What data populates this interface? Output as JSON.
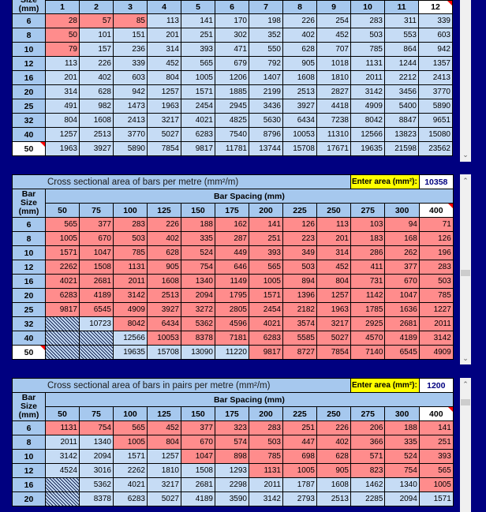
{
  "colors": {
    "background": "#000080",
    "header_fill": "#a6c8ee",
    "cell_fill": "#c6dcf5",
    "highlight_fill": "#ff8c8c",
    "enter_area_fill": "#ffff00"
  },
  "table1": {
    "row_header_label_partial": "Size",
    "row_header_unit": "(mm)",
    "columns": [
      "1",
      "2",
      "3",
      "4",
      "5",
      "6",
      "7",
      "8",
      "9",
      "10",
      "11",
      "12"
    ],
    "selected_column": "12",
    "rows": [
      {
        "size": "6",
        "values": [
          "28",
          "57",
          "85",
          "113",
          "141",
          "170",
          "198",
          "226",
          "254",
          "283",
          "311",
          "339"
        ],
        "flags": [
          "r",
          "r",
          "r",
          "l",
          "l",
          "l",
          "l",
          "l",
          "l",
          "l",
          "l",
          "l"
        ]
      },
      {
        "size": "8",
        "values": [
          "50",
          "101",
          "151",
          "201",
          "251",
          "302",
          "352",
          "402",
          "452",
          "503",
          "553",
          "603"
        ],
        "flags": [
          "r",
          "l",
          "l",
          "l",
          "l",
          "l",
          "l",
          "l",
          "l",
          "l",
          "l",
          "l"
        ]
      },
      {
        "size": "10",
        "values": [
          "79",
          "157",
          "236",
          "314",
          "393",
          "471",
          "550",
          "628",
          "707",
          "785",
          "864",
          "942"
        ],
        "flags": [
          "r",
          "l",
          "l",
          "l",
          "l",
          "l",
          "l",
          "l",
          "l",
          "l",
          "l",
          "l"
        ]
      },
      {
        "size": "12",
        "values": [
          "113",
          "226",
          "339",
          "452",
          "565",
          "679",
          "792",
          "905",
          "1018",
          "1131",
          "1244",
          "1357"
        ],
        "flags": [
          "l",
          "l",
          "l",
          "l",
          "l",
          "l",
          "l",
          "l",
          "l",
          "l",
          "l",
          "l"
        ]
      },
      {
        "size": "16",
        "values": [
          "201",
          "402",
          "603",
          "804",
          "1005",
          "1206",
          "1407",
          "1608",
          "1810",
          "2011",
          "2212",
          "2413"
        ],
        "flags": [
          "l",
          "l",
          "l",
          "l",
          "l",
          "l",
          "l",
          "l",
          "l",
          "l",
          "l",
          "l"
        ]
      },
      {
        "size": "20",
        "values": [
          "314",
          "628",
          "942",
          "1257",
          "1571",
          "1885",
          "2199",
          "2513",
          "2827",
          "3142",
          "3456",
          "3770"
        ],
        "flags": [
          "l",
          "l",
          "l",
          "l",
          "l",
          "l",
          "l",
          "l",
          "l",
          "l",
          "l",
          "l"
        ]
      },
      {
        "size": "25",
        "values": [
          "491",
          "982",
          "1473",
          "1963",
          "2454",
          "2945",
          "3436",
          "3927",
          "4418",
          "4909",
          "5400",
          "5890"
        ],
        "flags": [
          "l",
          "l",
          "l",
          "l",
          "l",
          "l",
          "l",
          "l",
          "l",
          "l",
          "l",
          "l"
        ]
      },
      {
        "size": "32",
        "values": [
          "804",
          "1608",
          "2413",
          "3217",
          "4021",
          "4825",
          "5630",
          "6434",
          "7238",
          "8042",
          "8847",
          "9651"
        ],
        "flags": [
          "l",
          "l",
          "l",
          "l",
          "l",
          "l",
          "l",
          "l",
          "l",
          "l",
          "l",
          "l"
        ]
      },
      {
        "size": "40",
        "values": [
          "1257",
          "2513",
          "3770",
          "5027",
          "6283",
          "7540",
          "8796",
          "10053",
          "11310",
          "12566",
          "13823",
          "15080"
        ],
        "flags": [
          "l",
          "l",
          "l",
          "l",
          "l",
          "l",
          "l",
          "l",
          "l",
          "l",
          "l",
          "l"
        ]
      },
      {
        "size": "50",
        "values": [
          "1963",
          "3927",
          "5890",
          "7854",
          "9817",
          "11781",
          "13744",
          "15708",
          "17671",
          "19635",
          "21598",
          "23562"
        ],
        "flags": [
          "l",
          "l",
          "l",
          "l",
          "l",
          "l",
          "l",
          "l",
          "l",
          "l",
          "l",
          "l"
        ],
        "selected": true
      }
    ]
  },
  "table2": {
    "title": "Cross sectional area of bars per metre (mm²/m)",
    "enter_label": "Enter area (mm²):",
    "enter_value": "10358",
    "bar_size_label": "Bar Size (mm)",
    "spacing_label": "Bar Spacing (mm)",
    "columns": [
      "50",
      "75",
      "100",
      "125",
      "150",
      "175",
      "200",
      "225",
      "250",
      "275",
      "300",
      "400"
    ],
    "selected_column": "400",
    "rows": [
      {
        "size": "6",
        "values": [
          "565",
          "377",
          "283",
          "226",
          "188",
          "162",
          "141",
          "126",
          "113",
          "103",
          "94",
          "71"
        ],
        "flags": [
          "r",
          "r",
          "r",
          "r",
          "r",
          "r",
          "r",
          "r",
          "r",
          "r",
          "r",
          "r"
        ]
      },
      {
        "size": "8",
        "values": [
          "1005",
          "670",
          "503",
          "402",
          "335",
          "287",
          "251",
          "223",
          "201",
          "183",
          "168",
          "126"
        ],
        "flags": [
          "r",
          "r",
          "r",
          "r",
          "r",
          "r",
          "r",
          "r",
          "r",
          "r",
          "r",
          "r"
        ]
      },
      {
        "size": "10",
        "values": [
          "1571",
          "1047",
          "785",
          "628",
          "524",
          "449",
          "393",
          "349",
          "314",
          "286",
          "262",
          "196"
        ],
        "flags": [
          "r",
          "r",
          "r",
          "r",
          "r",
          "r",
          "r",
          "r",
          "r",
          "r",
          "r",
          "r"
        ]
      },
      {
        "size": "12",
        "values": [
          "2262",
          "1508",
          "1131",
          "905",
          "754",
          "646",
          "565",
          "503",
          "452",
          "411",
          "377",
          "283"
        ],
        "flags": [
          "r",
          "r",
          "r",
          "r",
          "r",
          "r",
          "r",
          "r",
          "r",
          "r",
          "r",
          "r"
        ]
      },
      {
        "size": "16",
        "values": [
          "4021",
          "2681",
          "2011",
          "1608",
          "1340",
          "1149",
          "1005",
          "894",
          "804",
          "731",
          "670",
          "503"
        ],
        "flags": [
          "r",
          "r",
          "r",
          "r",
          "r",
          "r",
          "r",
          "r",
          "r",
          "r",
          "r",
          "r"
        ]
      },
      {
        "size": "20",
        "values": [
          "6283",
          "4189",
          "3142",
          "2513",
          "2094",
          "1795",
          "1571",
          "1396",
          "1257",
          "1142",
          "1047",
          "785"
        ],
        "flags": [
          "r",
          "r",
          "r",
          "r",
          "r",
          "r",
          "r",
          "r",
          "r",
          "r",
          "r",
          "r"
        ]
      },
      {
        "size": "25",
        "values": [
          "9817",
          "6545",
          "4909",
          "3927",
          "3272",
          "2805",
          "2454",
          "2182",
          "1963",
          "1785",
          "1636",
          "1227"
        ],
        "flags": [
          "r",
          "r",
          "r",
          "r",
          "r",
          "r",
          "r",
          "r",
          "r",
          "r",
          "r",
          "r"
        ]
      },
      {
        "size": "32",
        "values": [
          "",
          "10723",
          "8042",
          "6434",
          "5362",
          "4596",
          "4021",
          "3574",
          "3217",
          "2925",
          "2681",
          "2011"
        ],
        "flags": [
          "h",
          "l",
          "r",
          "r",
          "r",
          "r",
          "r",
          "r",
          "r",
          "r",
          "r",
          "r"
        ]
      },
      {
        "size": "40",
        "values": [
          "",
          "",
          "12566",
          "10053",
          "8378",
          "7181",
          "6283",
          "5585",
          "5027",
          "4570",
          "4189",
          "3142"
        ],
        "flags": [
          "h",
          "h",
          "l",
          "r",
          "r",
          "r",
          "r",
          "r",
          "r",
          "r",
          "r",
          "r"
        ]
      },
      {
        "size": "50",
        "values": [
          "",
          "",
          "19635",
          "15708",
          "13090",
          "11220",
          "9817",
          "8727",
          "7854",
          "7140",
          "6545",
          "4909"
        ],
        "flags": [
          "h",
          "h",
          "l",
          "l",
          "l",
          "l",
          "r",
          "r",
          "r",
          "r",
          "r",
          "r"
        ],
        "selected": true
      }
    ]
  },
  "table3": {
    "title": "Cross sectional area of bars in pairs per metre (mm²/m)",
    "enter_label": "Enter area (mm²):",
    "enter_value": "1200",
    "bar_size_label": "Bar Size (mm)",
    "spacing_label": "Bar Spacing (mm)",
    "columns": [
      "50",
      "75",
      "100",
      "125",
      "150",
      "175",
      "200",
      "225",
      "250",
      "275",
      "300",
      "400"
    ],
    "selected_column": "400",
    "rows": [
      {
        "size": "6",
        "values": [
          "1131",
          "754",
          "565",
          "452",
          "377",
          "323",
          "283",
          "251",
          "226",
          "206",
          "188",
          "141"
        ],
        "flags": [
          "r",
          "r",
          "r",
          "r",
          "r",
          "r",
          "r",
          "r",
          "r",
          "r",
          "r",
          "r"
        ]
      },
      {
        "size": "8",
        "values": [
          "2011",
          "1340",
          "1005",
          "804",
          "670",
          "574",
          "503",
          "447",
          "402",
          "366",
          "335",
          "251"
        ],
        "flags": [
          "l",
          "l",
          "r",
          "r",
          "r",
          "r",
          "r",
          "r",
          "r",
          "r",
          "r",
          "r"
        ]
      },
      {
        "size": "10",
        "values": [
          "3142",
          "2094",
          "1571",
          "1257",
          "1047",
          "898",
          "785",
          "698",
          "628",
          "571",
          "524",
          "393"
        ],
        "flags": [
          "l",
          "l",
          "l",
          "l",
          "r",
          "r",
          "r",
          "r",
          "r",
          "r",
          "r",
          "r"
        ]
      },
      {
        "size": "12",
        "values": [
          "4524",
          "3016",
          "2262",
          "1810",
          "1508",
          "1293",
          "1131",
          "1005",
          "905",
          "823",
          "754",
          "565"
        ],
        "flags": [
          "l",
          "l",
          "l",
          "l",
          "l",
          "l",
          "r",
          "r",
          "r",
          "r",
          "r",
          "r"
        ]
      },
      {
        "size": "16",
        "values": [
          "",
          "5362",
          "4021",
          "3217",
          "2681",
          "2298",
          "2011",
          "1787",
          "1608",
          "1462",
          "1340",
          "1005"
        ],
        "flags": [
          "h",
          "l",
          "l",
          "l",
          "l",
          "l",
          "l",
          "l",
          "l",
          "l",
          "l",
          "r"
        ]
      },
      {
        "size": "20",
        "values": [
          "",
          "8378",
          "6283",
          "5027",
          "4189",
          "3590",
          "3142",
          "2793",
          "2513",
          "2285",
          "2094",
          "1571"
        ],
        "flags": [
          "h",
          "l",
          "l",
          "l",
          "l",
          "l",
          "l",
          "l",
          "l",
          "l",
          "l",
          "l"
        ]
      }
    ]
  },
  "scrollbars": {
    "up_icon": "^",
    "down_icon": "v",
    "thumb_positions": {
      "table1": null,
      "table2": 0.55,
      "table3": 0.05
    }
  }
}
